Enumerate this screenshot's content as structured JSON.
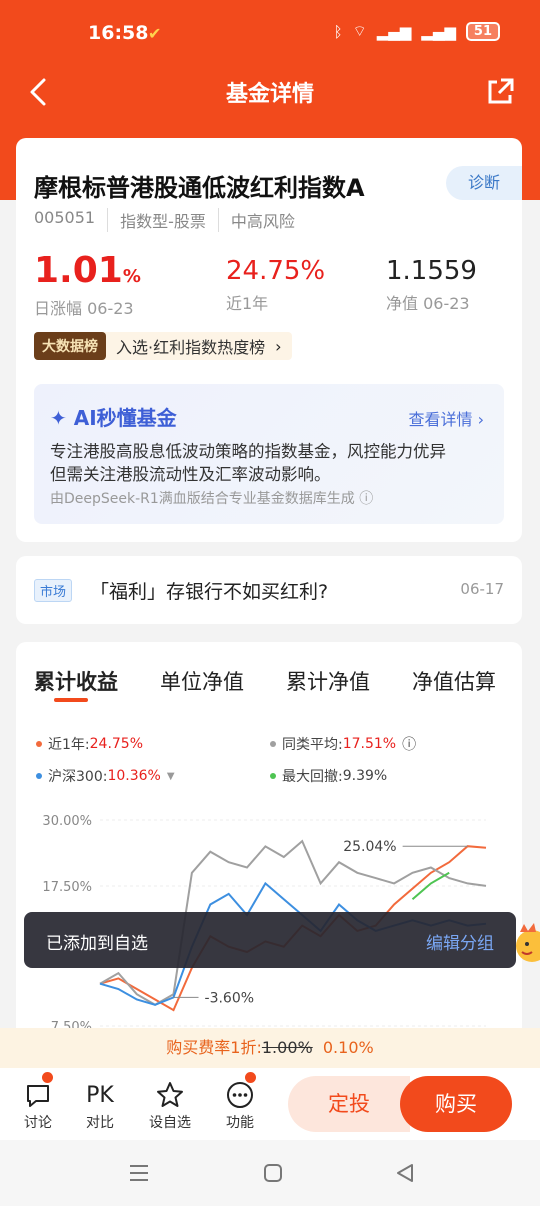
{
  "status": {
    "time": "16:58",
    "battery": "51"
  },
  "nav": {
    "title": "基金详情"
  },
  "fund": {
    "name": "摩根标普港股通低波红利指数A",
    "diagnose": "诊断",
    "code": "005051",
    "type": "指数型-股票",
    "risk": "中高风险",
    "daily_change": "1.01",
    "daily_change_unit": "%",
    "daily_label": "日涨幅 06-23",
    "year_return": "24.75%",
    "year_label": "近1年",
    "nav_value": "1.1559",
    "nav_label": "净值 06-23",
    "bigdata_tag": "大数据榜",
    "rank_text": "入选·红利指数热度榜"
  },
  "ai": {
    "title": "AI秒懂基金",
    "more": "查看详情",
    "line1": "专注港股高股息低波动策略的指数基金，风控能力优异",
    "line2": "但需关注港股流动性及汇率波动影响。",
    "footer": "由DeepSeek-R1满血版结合专业基金数据库生成"
  },
  "news": {
    "badge": "市场",
    "title": "「福利」存银行不如买红利?",
    "date": "06-17"
  },
  "chart_tabs": [
    "累计收益",
    "单位净值",
    "累计净值",
    "净值估算"
  ],
  "legend": {
    "fund_label": "近1年:",
    "fund_value": "24.75%",
    "avg_label": "同类平均:",
    "avg_value": "17.51%",
    "hs_label": "沪深300:",
    "hs_value": "10.36%",
    "dd_label": "最大回撤:",
    "dd_value": "9.39%"
  },
  "colors": {
    "fund": "#f26a3c",
    "avg": "#a0a0a0",
    "hs300": "#3d8fe0",
    "drawdown": "#4ec452",
    "brand": "#f24a1c"
  },
  "chart_data": {
    "type": "line",
    "y_ticks": [
      "30.00%",
      "17.50%",
      "7.50%"
    ],
    "annotations": [
      "25.04%",
      "-3.60%"
    ],
    "series": [
      {
        "name": "近1年",
        "values": [
          -1,
          0,
          -2,
          -4,
          -6,
          2,
          8,
          6,
          5,
          7,
          6,
          10,
          8,
          12,
          9,
          10,
          14,
          17,
          20,
          22,
          25.04,
          24.75
        ]
      },
      {
        "name": "同类平均",
        "values": [
          -1,
          1,
          -3,
          -5,
          -3,
          20,
          24,
          22,
          21,
          25,
          23,
          26,
          18,
          22,
          20,
          19,
          18,
          20,
          21,
          19,
          18,
          17.51
        ]
      },
      {
        "name": "沪深300",
        "values": [
          -1,
          -2,
          -4,
          -5,
          -3.6,
          6,
          14,
          16,
          12,
          18,
          15,
          12,
          9,
          14,
          11,
          9,
          10,
          11,
          10,
          11,
          10,
          10.36
        ]
      }
    ]
  },
  "toast": {
    "text": "已添加到自选",
    "action": "编辑分组"
  },
  "promo": {
    "prefix": "购买费率1折:",
    "old": "1.00%",
    "new": "0.10%"
  },
  "bottom": {
    "discuss": "讨论",
    "pk_icon": "PK",
    "compare": "对比",
    "watch": "设自选",
    "func": "功能",
    "fixed": "定投",
    "buy": "购买"
  }
}
